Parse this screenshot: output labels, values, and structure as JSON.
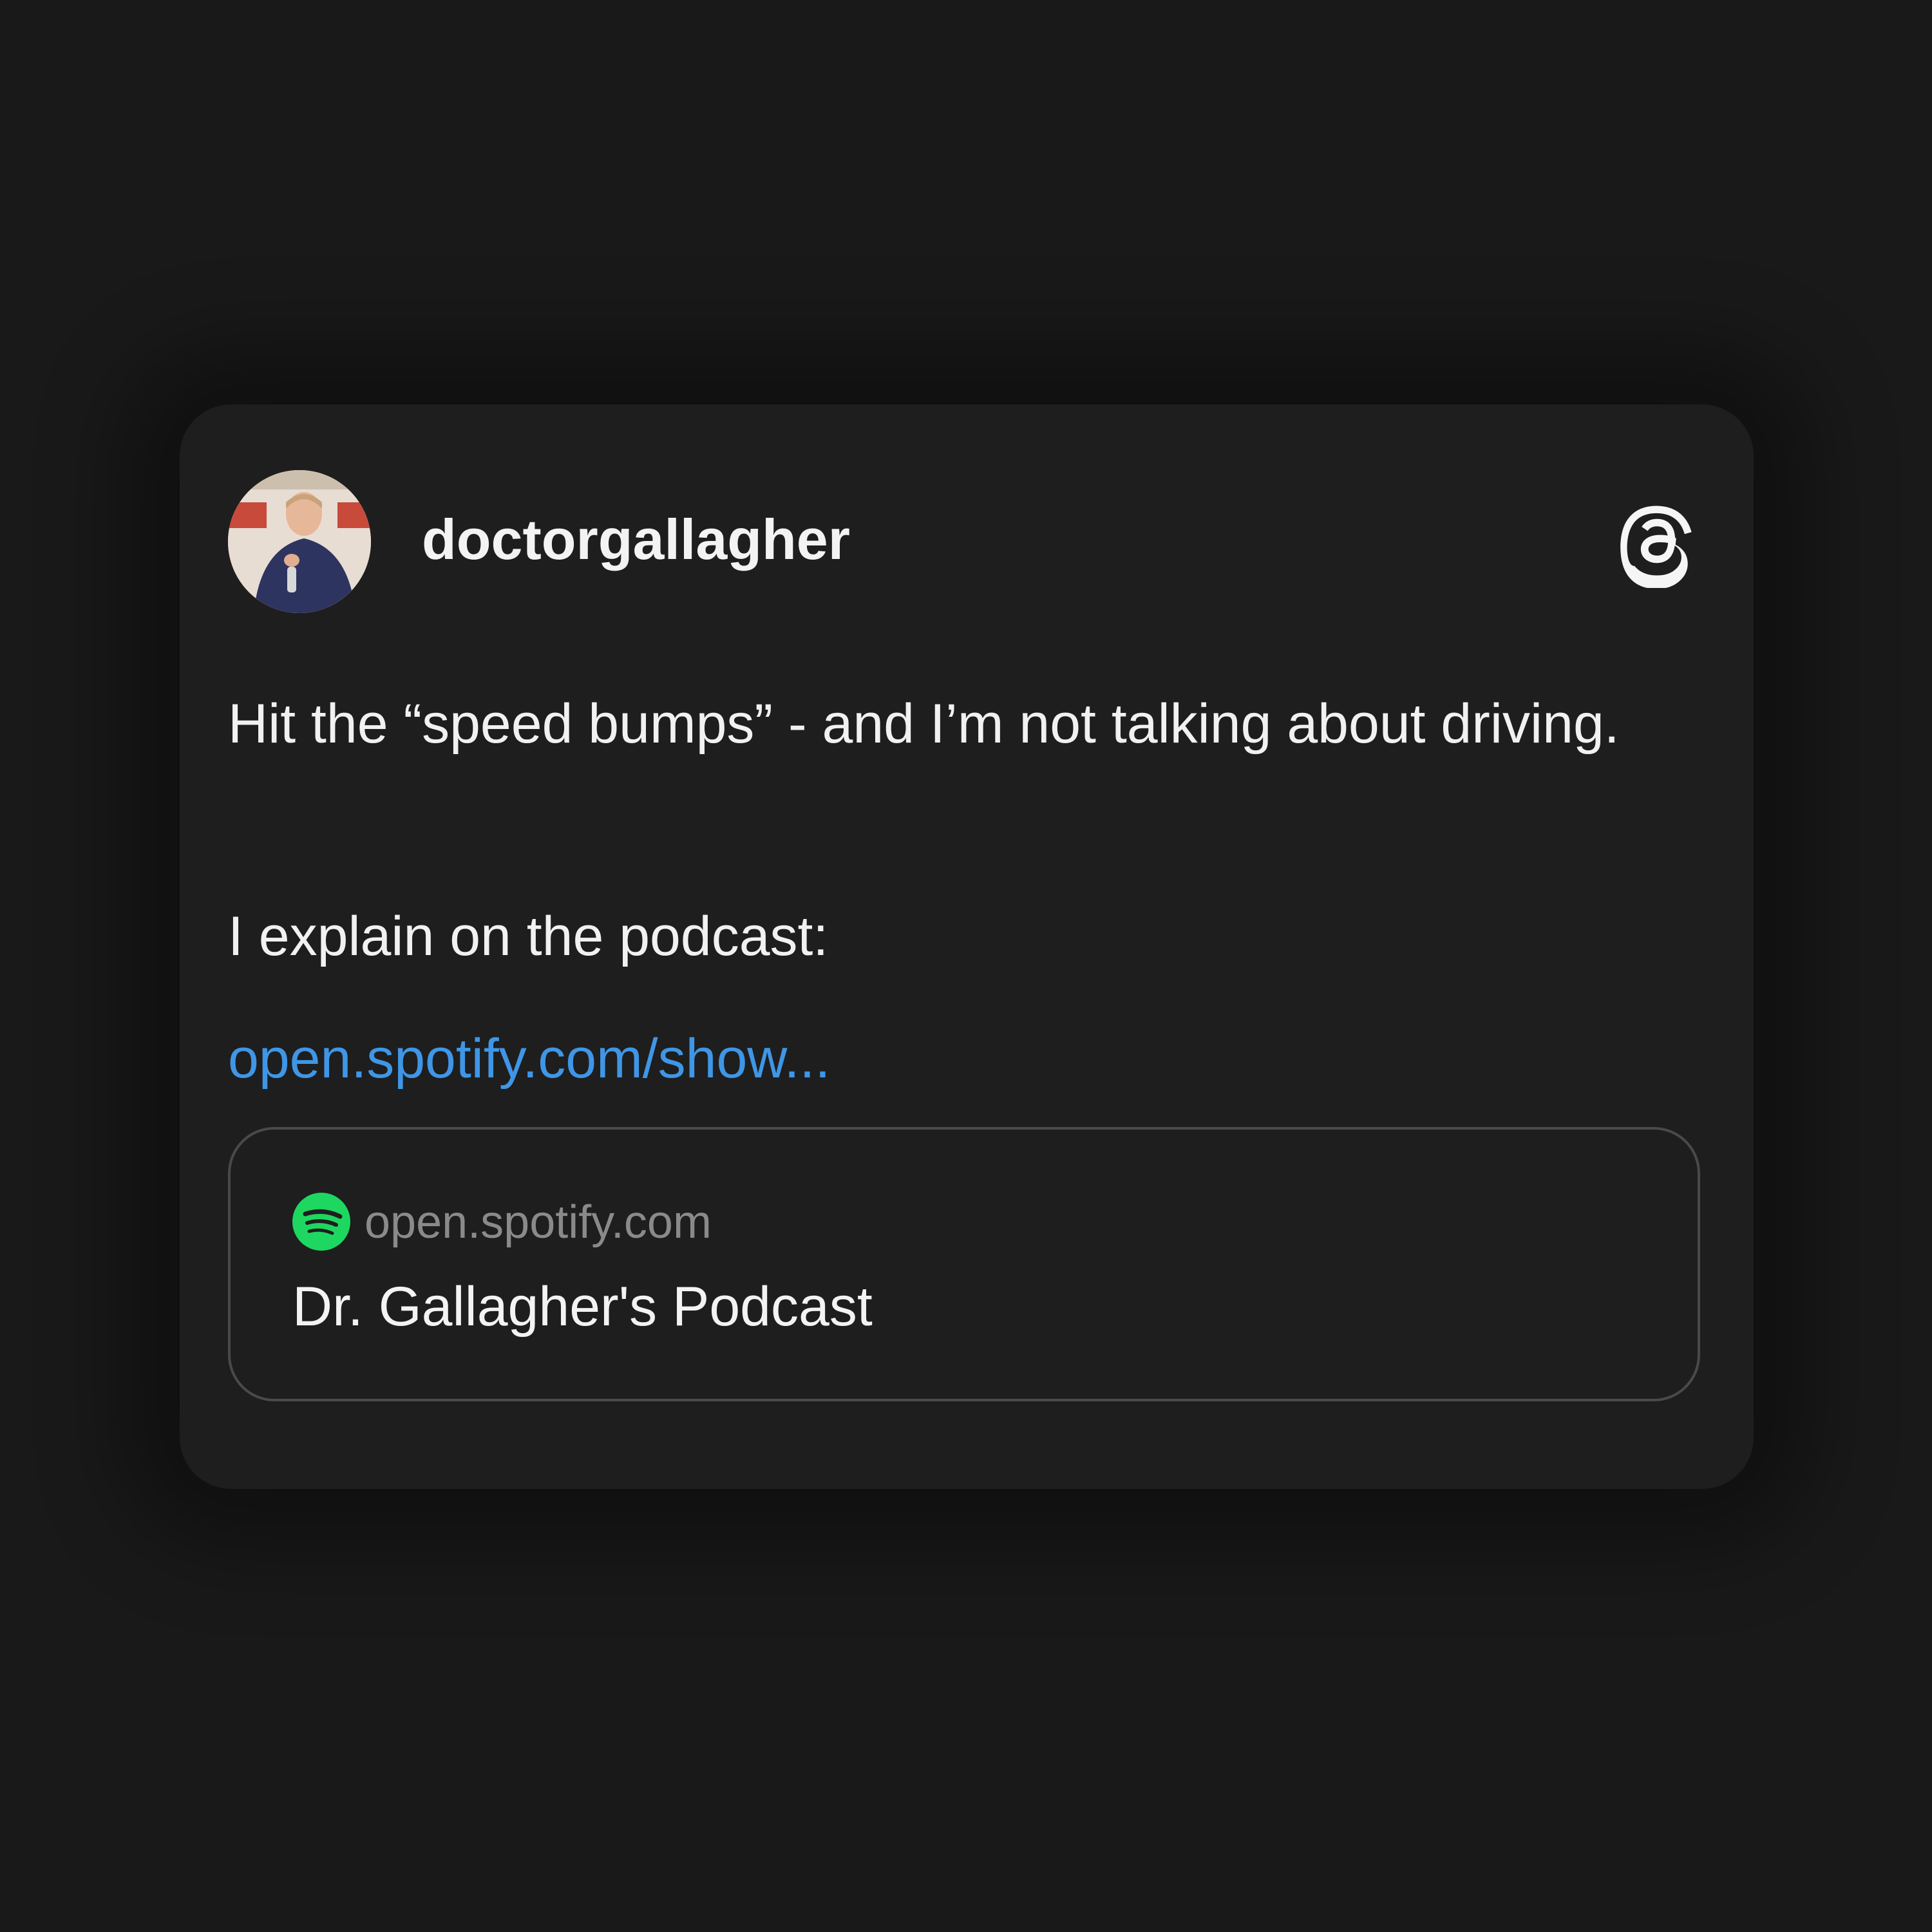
{
  "post": {
    "username": "doctorgallagher",
    "text_paragraph_1": "Hit the “speed bumps” - and I’m not talking about driving.",
    "text_paragraph_2": "I explain on the podcast:",
    "link_text": "open.spotify.com/show...",
    "icons": {
      "avatar": "profile-photo",
      "brand": "threads-icon"
    }
  },
  "link_preview": {
    "domain": "open.spotify.com",
    "title": "Dr. Gallagher's Podcast",
    "icon": "spotify-icon"
  },
  "colors": {
    "background": "#191919",
    "card": "#1e1e1e",
    "text": "#f1f1f1",
    "link": "#3f96e6",
    "muted": "#8a8a8a",
    "spotify_green": "#1ed760"
  }
}
